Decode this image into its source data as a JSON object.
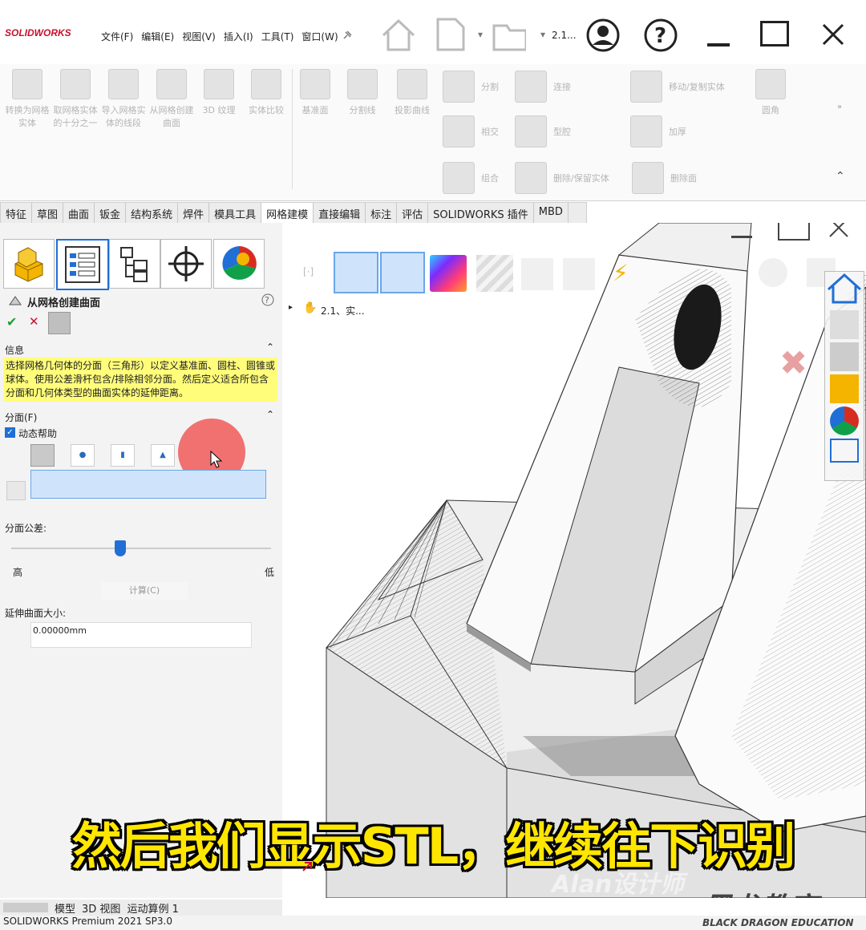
{
  "app": {
    "logo": "SOLIDWORKS",
    "menus": [
      "文件(F)",
      "编辑(E)",
      "视图(V)",
      "插入(I)",
      "工具(T)",
      "窗口(W)"
    ],
    "version_box": "2.1...",
    "status_text": "SOLIDWORKS Premium 2021 SP3.0"
  },
  "ribbon": {
    "large": [
      "转换为网格实体",
      "取网格实体的十分之一",
      "导入网格实体的线段",
      "从网格创建曲面",
      "3D 纹理",
      "实体比较",
      "基准面",
      "分割线",
      "投影曲线"
    ],
    "small": [
      "分割",
      "连接",
      "移动/复制实体",
      "圆角",
      "相交",
      "型腔",
      "加厚",
      "组合",
      "删除/保留实体",
      "删除面"
    ]
  },
  "tabs": [
    "特征",
    "草图",
    "曲面",
    "钣金",
    "结构系统",
    "焊件",
    "模具工具",
    "网格建模",
    "直接编辑",
    "标注",
    "评估",
    "SOLIDWORKS 插件",
    "MBD"
  ],
  "active_tab": "网格建模",
  "pm": {
    "title": "从网格创建曲面",
    "info_header": "信息",
    "info_text": "选择网格几何体的分面（三角形）以定义基准面、圆柱、圆锥或球体。使用公差滑杆包含/排除相邻分面。然后定义适合所包含分面和几何体类型的曲面实体的延伸距离。",
    "facets_header": "分面(F)",
    "dynamic_help": "动态帮助",
    "tolerance_label": "分面公差:",
    "slider_high": "高",
    "slider_low": "低",
    "slider_value": 0.42,
    "compute_button": "计算(C)",
    "extend_label": "延伸曲面大小:",
    "extend_value": "0.00000mm"
  },
  "tree": {
    "item": "2.1、实..."
  },
  "bottom_tabs": [
    "模型",
    "3D 视图",
    "运动算例 1"
  ],
  "overlay": {
    "subtitle": "然后我们显示STL，继续往下识别",
    "watermark_1": "Alan设计师",
    "watermark_2": "黑龙教育",
    "watermark_3": "BLACK DRAGON EDUCATION"
  },
  "colors": {
    "accent": "#1f6fd6",
    "info_bg": "#fffd7a",
    "subtitle": "#ffe600",
    "brand": "#c8102e"
  }
}
